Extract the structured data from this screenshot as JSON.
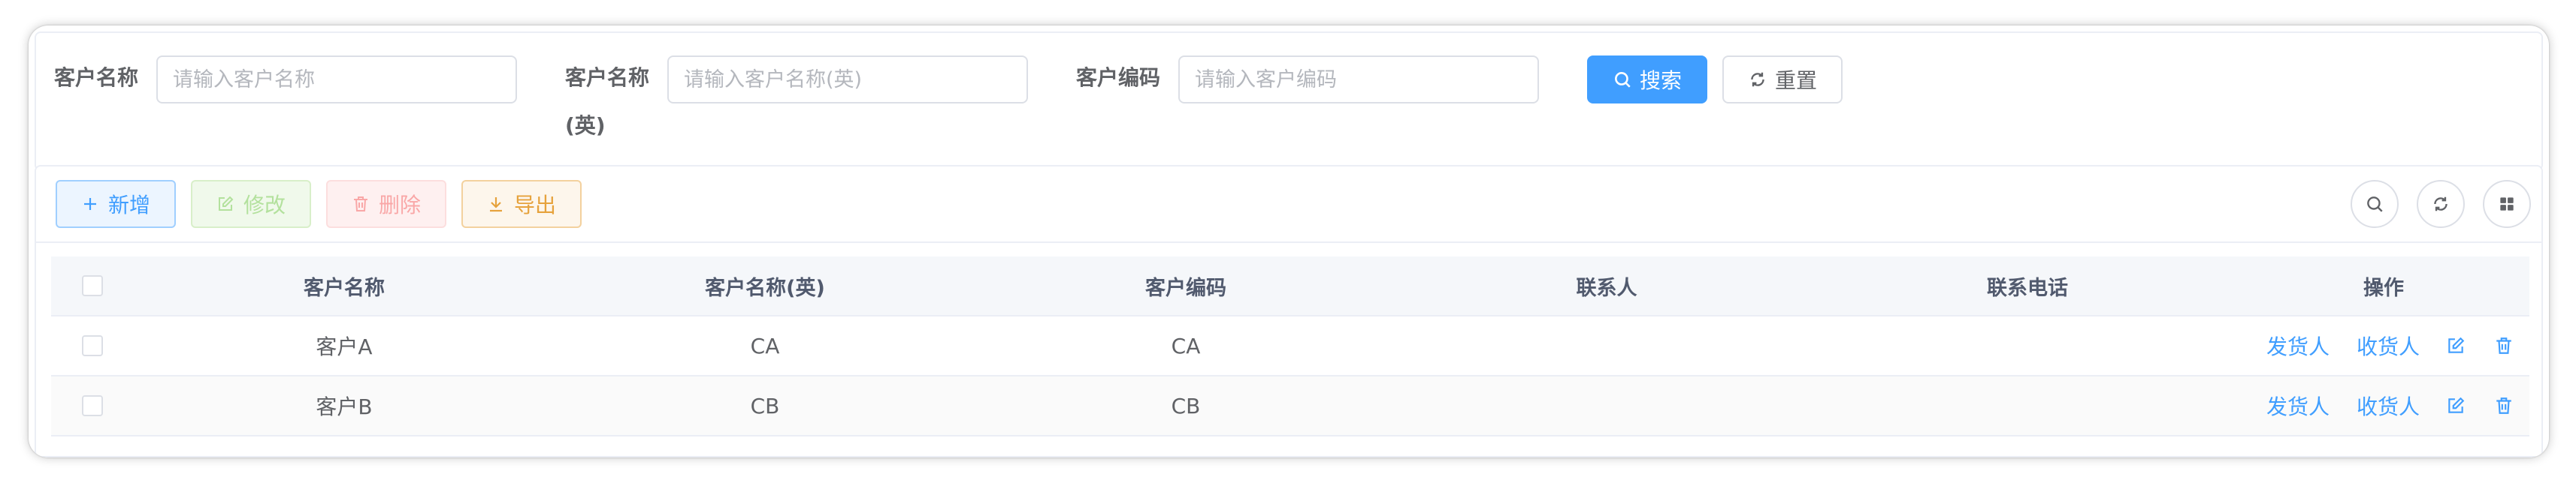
{
  "search": {
    "fields": [
      {
        "label": "客户名称",
        "placeholder": "请输入客户名称"
      },
      {
        "label": "客户名称",
        "label2": "(英)",
        "placeholder": "请输入客户名称(英)"
      },
      {
        "label": "客户编码",
        "placeholder": "请输入客户编码"
      }
    ],
    "search_label": "搜索",
    "reset_label": "重置"
  },
  "toolbar": {
    "add_label": "新增",
    "edit_label": "修改",
    "delete_label": "删除",
    "export_label": "导出",
    "right_icons": [
      "search-icon",
      "refresh-icon",
      "grid-icon"
    ]
  },
  "table": {
    "columns": [
      "客户名称",
      "客户名称(英)",
      "客户编码",
      "联系人",
      "联系电话",
      "操作"
    ],
    "rows": [
      {
        "name": "客户A",
        "name_en": "CA",
        "code": "CA",
        "contact": "",
        "phone": "",
        "actions": [
          "发货人",
          "收货人"
        ]
      },
      {
        "name": "客户B",
        "name_en": "CB",
        "code": "CB",
        "contact": "",
        "phone": "",
        "actions": [
          "发货人",
          "收货人"
        ]
      }
    ]
  },
  "colors": {
    "primary": "#409eff",
    "success_light": "#b3e19d",
    "danger_light": "#f9a7a7",
    "warning": "#e6a23c",
    "header_bg": "#f5f7fa"
  }
}
